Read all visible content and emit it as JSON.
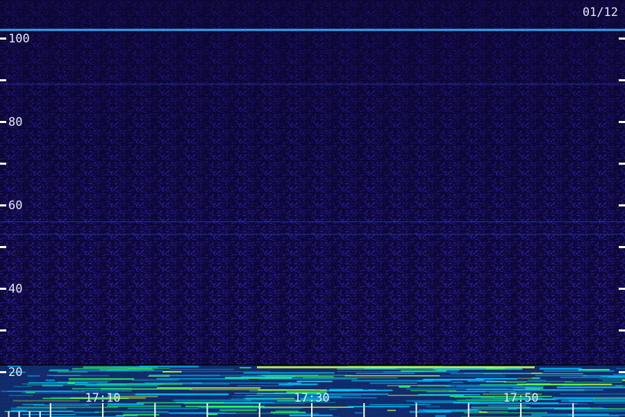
{
  "chart_data": {
    "type": "heatmap",
    "date_label": "01/12",
    "title": "",
    "xlabel": "",
    "ylabel": "",
    "y_range": [
      17,
      105
    ],
    "y_ticks": [
      30,
      50,
      70,
      90
    ],
    "y_tick_labels": [
      {
        "value": 100,
        "label": "100"
      },
      {
        "value": 80,
        "label": "80"
      },
      {
        "value": 60,
        "label": "60"
      },
      {
        "value": 40,
        "label": "40"
      },
      {
        "value": 20,
        "label": "20"
      }
    ],
    "x_range_minutes": [
      17.0,
      18.0
    ],
    "x_tick_labels": [
      {
        "value": "17:10",
        "minute": 10
      },
      {
        "value": "17:30",
        "minute": 30
      },
      {
        "value": "17:50",
        "minute": 50
      }
    ],
    "x_minor_ticks_minutes": [
      5,
      10,
      15,
      20,
      25,
      30,
      35,
      40,
      45,
      50,
      55
    ],
    "persistent_lines": [
      {
        "y": 102,
        "strength": "strong",
        "color": "#2fb0ff"
      },
      {
        "y": 89,
        "strength": "faint",
        "color": "#3b4fe0"
      },
      {
        "y": 56,
        "strength": "faint",
        "color": "#3b4fe0"
      },
      {
        "y": 53,
        "strength": "faint",
        "color": "#3b4fe0"
      }
    ],
    "intense_band": {
      "y_from": 17,
      "y_to": 21.5,
      "colors": [
        "#00c8ff",
        "#30ff60",
        "#d0ff40"
      ]
    },
    "colors": {
      "background": "#0d0838",
      "noise_low": "#1a1480",
      "noise_high": "#3a2ed8",
      "axis": "#ffffff"
    }
  }
}
